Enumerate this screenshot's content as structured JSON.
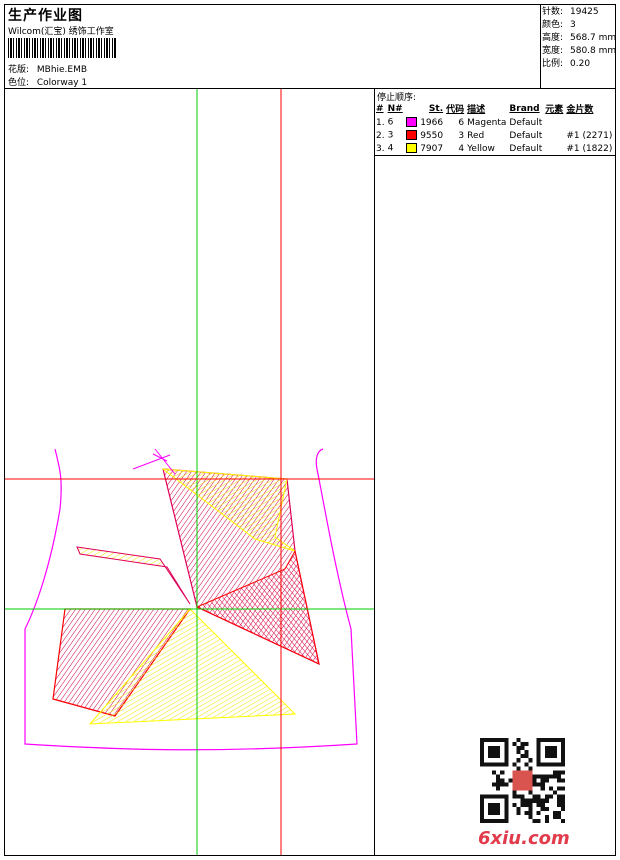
{
  "header": {
    "title": "生产作业图",
    "subtitle": "Wilcom(汇宝) 绣饰工作室",
    "design_label": "花版:",
    "design_value": "MBhie.EMB",
    "colorway_label": "色位:",
    "colorway_value": "Colorway 1"
  },
  "stats": {
    "stitches_label": "针数:",
    "stitches_value": "19425",
    "colors_label": "颜色:",
    "colors_value": "3",
    "height_label": "高度:",
    "height_value": "568.7 mm",
    "width_label": "宽度:",
    "width_value": "580.8 mm",
    "scale_label": "比例:",
    "scale_value": "0.20"
  },
  "stop_sequence": {
    "title": "停止顺序:",
    "headers": [
      "#",
      "N#",
      "St.",
      "代码",
      "描述",
      "Brand",
      "元素",
      "金片数"
    ],
    "rows": [
      {
        "idx": "1.",
        "n": "6",
        "color": "#ff00ff",
        "st": "1966",
        "code": "6",
        "desc": "Magenta",
        "brand": "Default",
        "elem": "",
        "sequins": ""
      },
      {
        "idx": "2.",
        "n": "3",
        "color": "#ff0000",
        "st": "9550",
        "code": "3",
        "desc": "Red",
        "brand": "Default",
        "elem": "",
        "sequins": "#1 (2271)"
      },
      {
        "idx": "3.",
        "n": "4",
        "color": "#ffff00",
        "st": "7907",
        "code": "4",
        "desc": "Yellow",
        "brand": "Default",
        "elem": "",
        "sequins": "#1 (1822)"
      }
    ]
  },
  "watermark": "6xiu.com",
  "colors": {
    "magenta": "#ff00ff",
    "red": "#ff0000",
    "yellow": "#ffff00",
    "green_guide": "#00cc00",
    "red_guide": "#ff0000"
  }
}
